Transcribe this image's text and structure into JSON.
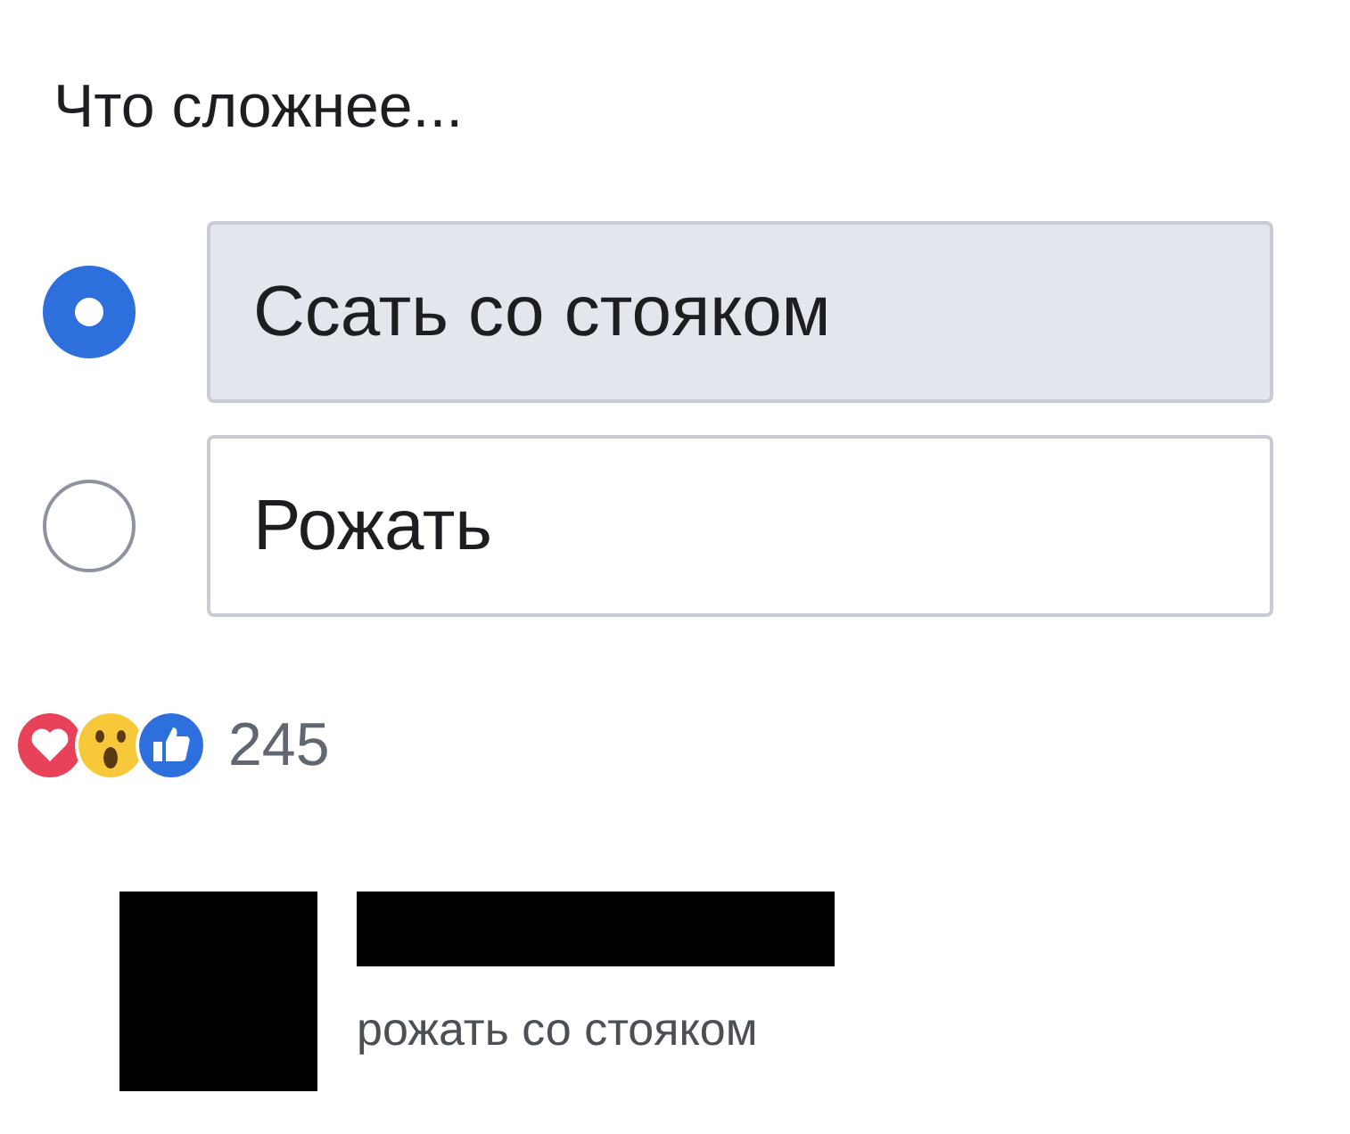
{
  "poll": {
    "question": "Что сложнее...",
    "options": [
      {
        "label": "Ссать со стояком",
        "selected": true
      },
      {
        "label": "Рожать",
        "selected": false
      }
    ]
  },
  "reactions": {
    "count": "245"
  },
  "comment": {
    "text": "рожать со стояком"
  }
}
